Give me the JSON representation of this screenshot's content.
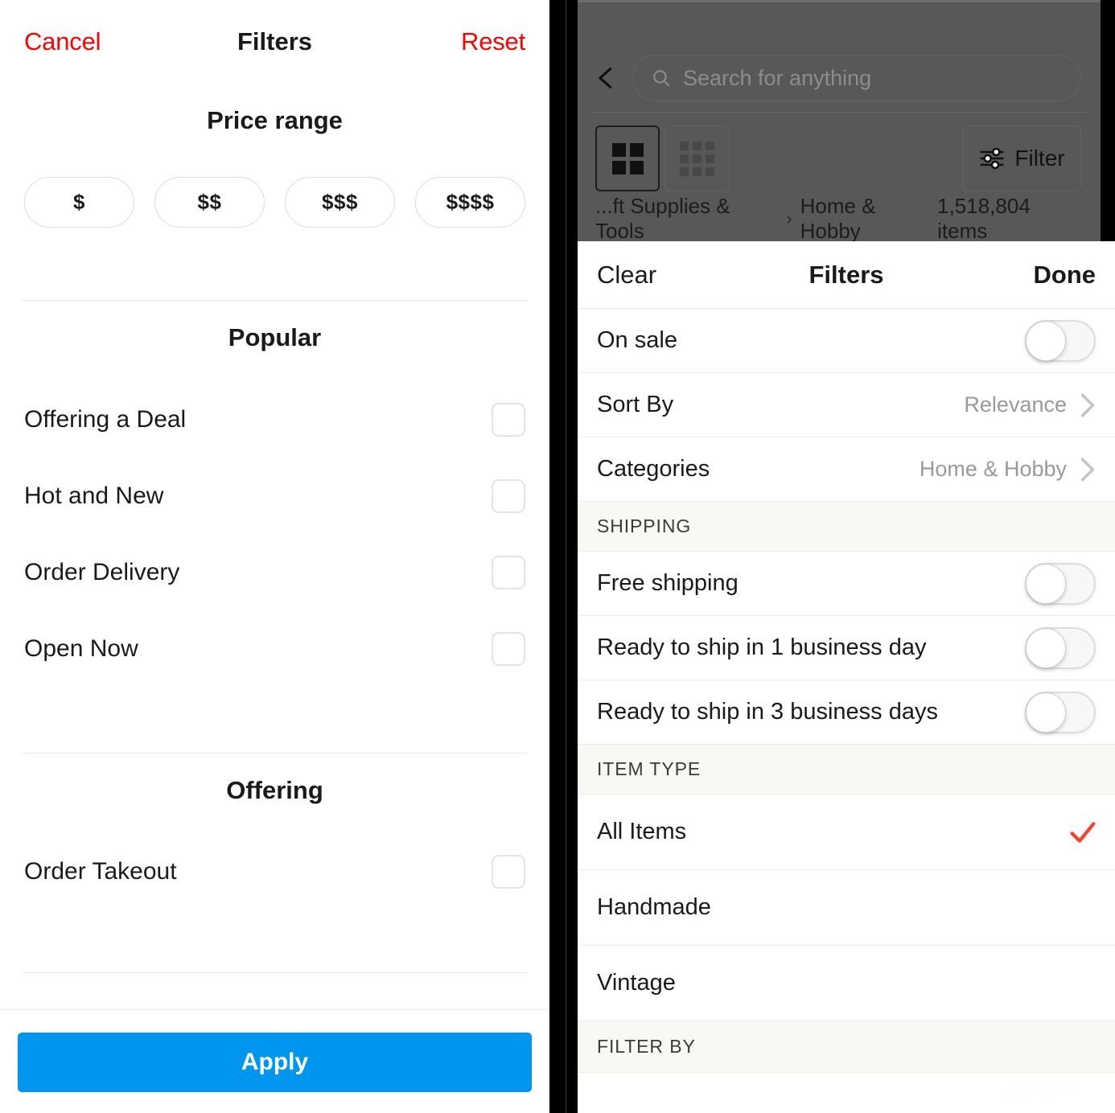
{
  "left_panel": {
    "topbar": {
      "cancel": "Cancel",
      "title": "Filters",
      "reset": "Reset"
    },
    "price": {
      "heading": "Price range",
      "options": [
        "$",
        "$$",
        "$$$",
        "$$$$"
      ]
    },
    "popular": {
      "heading": "Popular",
      "items": [
        {
          "label": "Offering a Deal",
          "checked": false
        },
        {
          "label": "Hot and New",
          "checked": false
        },
        {
          "label": "Order Delivery",
          "checked": false
        },
        {
          "label": "Open Now",
          "checked": false
        }
      ]
    },
    "offering": {
      "heading": "Offering",
      "items": [
        {
          "label": "Order Takeout",
          "checked": false
        }
      ]
    },
    "apply_label": "Apply",
    "colors": {
      "accent_red": "#ff0000",
      "apply_blue": "#0096f0"
    }
  },
  "right_panel": {
    "header": {
      "back_icon": "back-chevron-icon",
      "search_placeholder": "Search for anything",
      "search_value": "",
      "search_icon": "search-icon",
      "view_grid_2": "grid-2x2-icon",
      "view_grid_3": "grid-3x3-icon",
      "filter_icon": "tune-sliders-icon",
      "filter_label": "Filter",
      "breadcrumb_prefix": "...ft Supplies & Tools",
      "breadcrumb_separator": "›",
      "breadcrumb_current": "Home & Hobby",
      "item_count": "1,518,804 items"
    },
    "sheet": {
      "clear": "Clear",
      "title": "Filters",
      "done": "Done",
      "rows": [
        {
          "label": "On sale",
          "type": "toggle",
          "value": "off"
        },
        {
          "label": "Sort By",
          "type": "nav",
          "value": "Relevance"
        },
        {
          "label": "Categories",
          "type": "nav",
          "value": "Home & Hobby"
        }
      ],
      "shipping": {
        "heading": "SHIPPING",
        "rows": [
          {
            "label": "Free shipping",
            "type": "toggle",
            "value": "off"
          },
          {
            "label": "Ready to ship in 1 business day",
            "type": "toggle",
            "value": "off"
          },
          {
            "label": "Ready to ship in 3 business days",
            "type": "toggle",
            "value": "off"
          }
        ]
      },
      "item_type": {
        "heading": "ITEM TYPE",
        "rows": [
          {
            "label": "All Items",
            "selected": true
          },
          {
            "label": "Handmade",
            "selected": false
          },
          {
            "label": "Vintage",
            "selected": false
          }
        ]
      },
      "filter_by": {
        "heading": "FILTER BY"
      },
      "colors": {
        "check_red": "#f8402a",
        "section_bg": "#f8f8f4"
      }
    }
  },
  "watermark": {
    "main": "AAA",
    "sub": "教育"
  }
}
